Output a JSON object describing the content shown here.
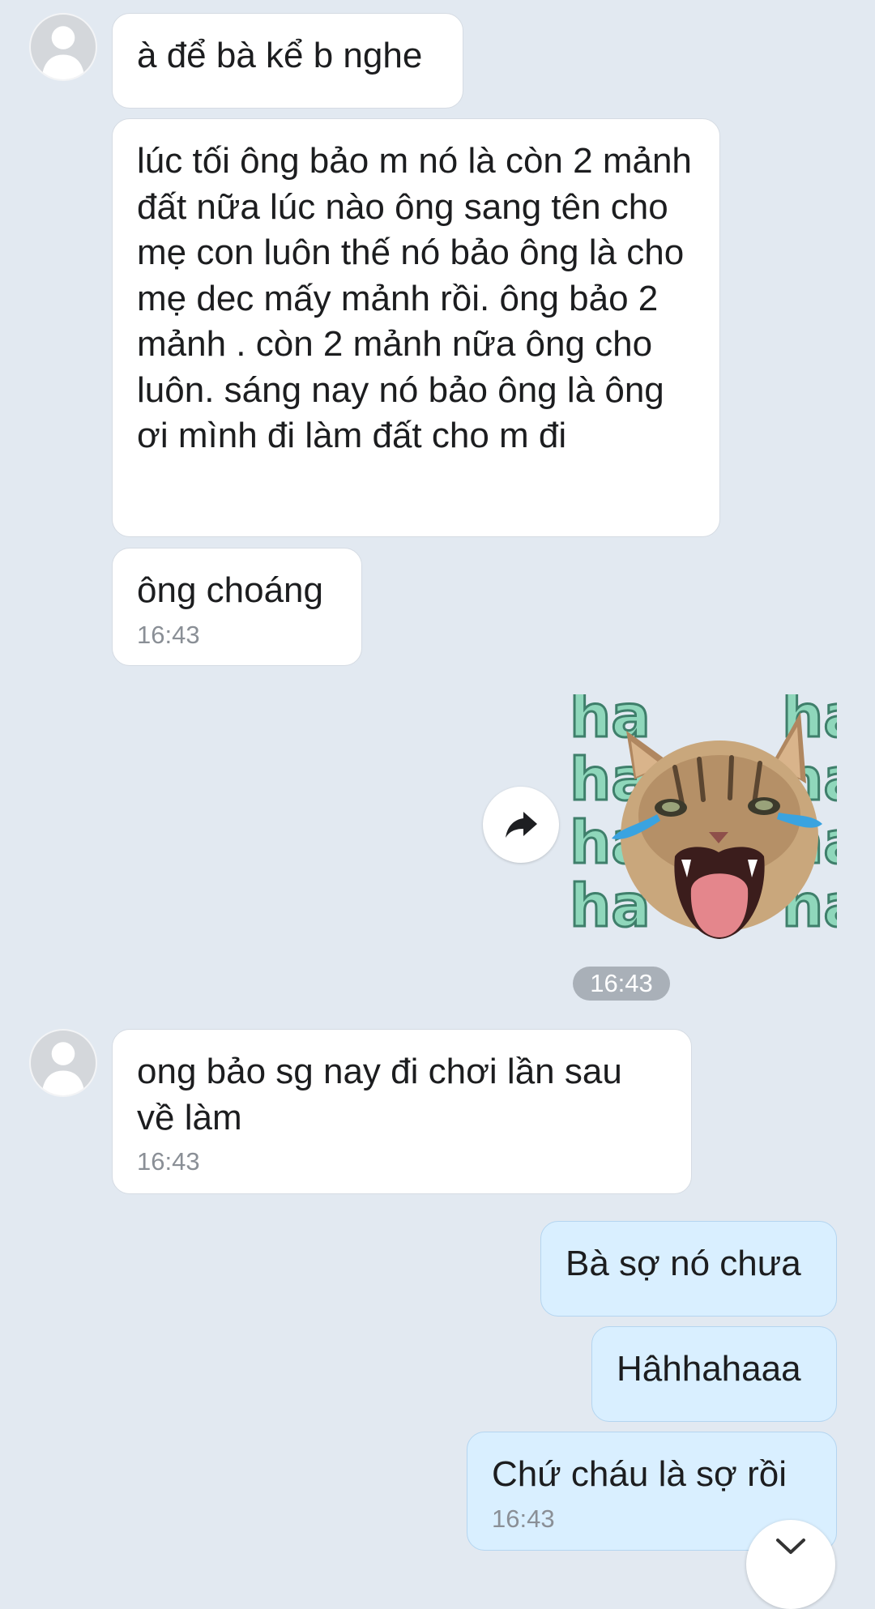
{
  "messages": [
    {
      "sender": "other",
      "text": "à để bà kể b nghe"
    },
    {
      "sender": "other",
      "text": "lúc tối ông bảo m nó là còn  2 mảnh đất nữa lúc nào ông sang tên cho mẹ con luôn thế nó bảo ông là cho mẹ dec mấy mảnh rồi. ông bảo 2 mảnh  . còn 2 mảnh nữa ông cho luôn. sáng nay nó bảo ông là ông ơi mình đi làm đất cho m đi"
    },
    {
      "sender": "other",
      "text": "ông choáng",
      "time": "16:43"
    },
    {
      "sender": "me",
      "type": "sticker",
      "sticker_text": [
        "ha",
        "ha",
        "ha",
        "ha"
      ],
      "time": "16:43"
    },
    {
      "sender": "other",
      "text": "ong bảo sg nay đi chơi lần sau về làm",
      "time": "16:43"
    },
    {
      "sender": "me",
      "text": "Bà sợ nó chưa"
    },
    {
      "sender": "me",
      "text": "Hâhhahaaa"
    },
    {
      "sender": "me",
      "text": "Chứ cháu là sợ rồi",
      "time": "16:43"
    }
  ],
  "icons": {
    "avatar": "default-user-avatar-icon",
    "share": "share-forward-icon",
    "scroll": "chevron-down-icon"
  },
  "colors": {
    "background": "#e2e9f1",
    "incoming_bubble": "#ffffff",
    "outgoing_bubble": "#d9efff",
    "timestamp": "#8a8f96"
  }
}
